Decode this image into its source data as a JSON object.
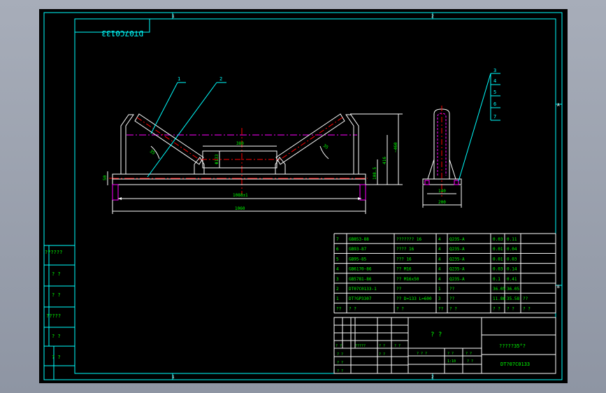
{
  "drawing": {
    "mirrored_code": "DT07C0133",
    "zone_numbers": [
      "1",
      "2"
    ],
    "zone_letters": [
      "A",
      "B"
    ],
    "balloons": [
      "1",
      "2",
      "3",
      "4",
      "5",
      "6",
      "7"
    ]
  },
  "dimensions": {
    "front": {
      "top_overall": "1088±1",
      "bottom_overall": "1060",
      "center_roll": "380",
      "roll_height": "Φ133",
      "left_height": "50",
      "angle_left": "35",
      "angle_right": "35",
      "right_outer": "~460",
      "right_mid": "416",
      "right_inner": "108.5"
    },
    "side": {
      "inner_width": "140",
      "outer_width": "200"
    }
  },
  "parts_table": {
    "rows": [
      {
        "no": "7",
        "code": "GB853-88",
        "name": "??????? 16",
        "qty": "4",
        "material": "Q235-A",
        "unit_wt": "0.03",
        "total_wt": "0.11",
        "note": ""
      },
      {
        "no": "6",
        "code": "GB93-87",
        "name": "???? 16",
        "qty": "4",
        "material": "Q235-A",
        "unit_wt": "0.01",
        "total_wt": "0.04",
        "note": ""
      },
      {
        "no": "5",
        "code": "GB95-85",
        "name": "??? 16",
        "qty": "4",
        "material": "Q235-A",
        "unit_wt": "0.01",
        "total_wt": "0.03",
        "note": ""
      },
      {
        "no": "4",
        "code": "GB6170-86",
        "name": "?? M16",
        "qty": "4",
        "material": "Q235-A",
        "unit_wt": "0.03",
        "total_wt": "0.14",
        "note": ""
      },
      {
        "no": "3",
        "code": "GB5781-86",
        "name": "?? M16x50",
        "qty": "4",
        "material": "Q235-A",
        "unit_wt": "0.1",
        "total_wt": "0.41",
        "note": ""
      },
      {
        "no": "2",
        "code": "DT07C0133-1",
        "name": "??",
        "qty": "1",
        "material": "??",
        "unit_wt": "36.05",
        "total_wt": "36.05",
        "note": ""
      },
      {
        "no": "1",
        "code": "DT?GP3307",
        "name": "?? D=133 L=600",
        "qty": "3",
        "material": "??",
        "unit_wt": "11.86",
        "total_wt": "35.58",
        "note": "??"
      }
    ],
    "header": {
      "no": "??",
      "code": "? ?",
      "name": "? ?",
      "qty": "??",
      "material": "? ?",
      "unit_wt": "? ?",
      "total_wt": "? ?",
      "note": "? ?"
    },
    "weight_header_top": "? ?"
  },
  "title_block": {
    "title": "? ?",
    "description": "?????35°?",
    "drawing_no": "DT?07C0133",
    "scale_label": "? ?",
    "scale": "1:10",
    "sheet_label": "? ?",
    "sheet": "? ?",
    "approve": "? ? ?",
    "small_1": "? ?",
    "small_2": "?????",
    "small_3": "? ?",
    "small_4": "? ?",
    "small_5": "? ?",
    "small_6": "? ?",
    "small_7": "? ?",
    "small_8": "? ?"
  },
  "left_stamps": [
    "??????",
    "? ?",
    "? ?",
    "?????",
    "? ?",
    "? ?"
  ],
  "colors": {
    "frame": "#00ffff",
    "geometry": "#ffffff",
    "dimension": "#00ff00",
    "centerline": "#ff0000",
    "hidden": "#ff00ff",
    "leader": "#00ffff",
    "text": "#00ff00"
  }
}
